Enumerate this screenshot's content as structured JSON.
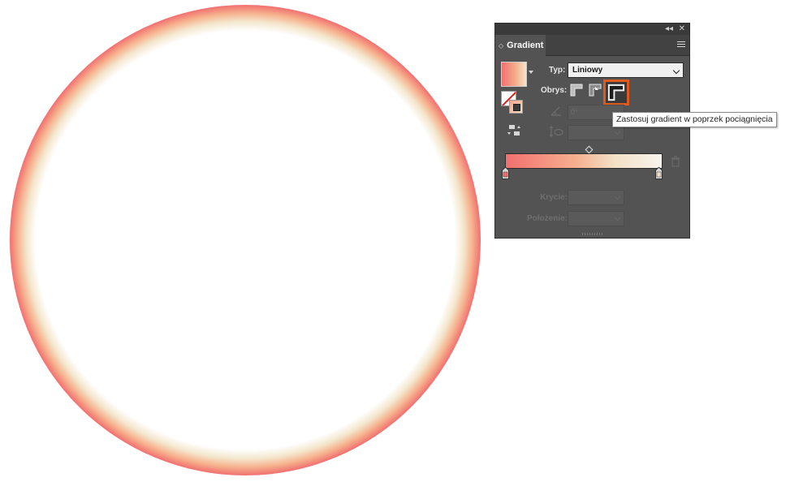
{
  "colors": {
    "ring_outer": "#f26f6f",
    "ring_mid": "#f6b28e",
    "ring_inner": "#f4e6cc",
    "panel_bg": "#535353",
    "highlight_orange": "#e05a1b"
  },
  "panel": {
    "title": "Gradient",
    "top_controls": {
      "collapse_icon": "double-chevron-left-icon",
      "close_icon": "close-icon"
    },
    "menu_icon": "hamburger-menu-icon",
    "type": {
      "label": "Typ:",
      "value": "Liniowy"
    },
    "stroke": {
      "label": "Obrys:",
      "selected_index": 3
    },
    "angle": {
      "value": "0°"
    },
    "opacity": {
      "label": "Krycie:"
    },
    "location": {
      "label": "Położenie:"
    }
  },
  "tooltip": {
    "text": "Zastosuj gradient w poprzek pociągnięcia"
  }
}
